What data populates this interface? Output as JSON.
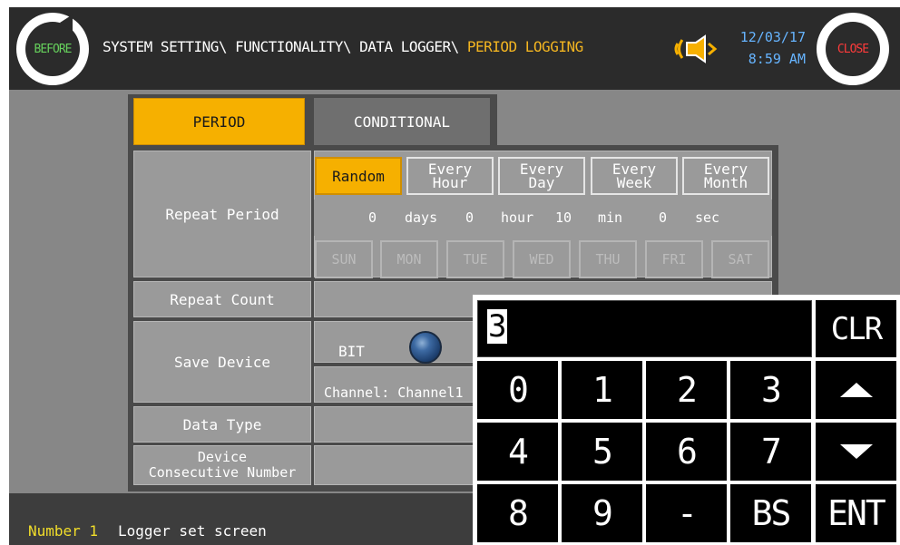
{
  "header": {
    "before_label": "BEFORE",
    "close_label": "CLOSE",
    "breadcrumb_path": "SYSTEM SETTING\\ FUNCTIONALITY\\ DATA LOGGER\\",
    "breadcrumb_current": "PERIOD LOGGING",
    "date": "12/03/17",
    "time": "8:59 AM",
    "sound_icon": "speaker-sound-icon"
  },
  "tabs": {
    "period": "PERIOD",
    "conditional": "CONDITIONAL",
    "active": "PERIOD"
  },
  "settings": {
    "repeat_period": {
      "label": "Repeat Period",
      "options": [
        "Random",
        "Every\nHour",
        "Every\nDay",
        "Every\nWeek",
        "Every\nMonth"
      ],
      "selected": "Random",
      "days_value": "0",
      "days_unit": "days",
      "hour_value": "0",
      "hour_unit": "hour",
      "min_value": "10",
      "min_unit": "min",
      "sec_value": "0",
      "sec_unit": "sec",
      "weekdays": [
        "SUN",
        "MON",
        "TUE",
        "WED",
        "THU",
        "FRI",
        "SAT"
      ]
    },
    "repeat_count": {
      "label": "Repeat Count"
    },
    "save_device": {
      "label": "Save Device",
      "bit_label": "BIT",
      "channel_label": "Channel: Channel1"
    },
    "data_type": {
      "label": "Data Type"
    },
    "device_consecutive": {
      "label": "Device\nConsecutive Number"
    }
  },
  "status_bar": {
    "number": "Number 1",
    "text": "Logger set screen"
  },
  "keypad": {
    "value": "3",
    "keys": {
      "clr": "CLR",
      "k0": "0",
      "k1": "1",
      "k2": "2",
      "k3": "3",
      "k4": "4",
      "k5": "5",
      "k6": "6",
      "k7": "7",
      "k8": "8",
      "k9": "9",
      "minus": "-",
      "bs": "BS",
      "ent": "ENT",
      "up": "up-arrow-icon",
      "down": "down-arrow-icon"
    }
  },
  "colors": {
    "accent": "#f6b000",
    "header_bg": "#2b2b2b",
    "panel_bg": "#878787",
    "status_yellow": "#f2de2a",
    "time_blue": "#66b4ff"
  }
}
